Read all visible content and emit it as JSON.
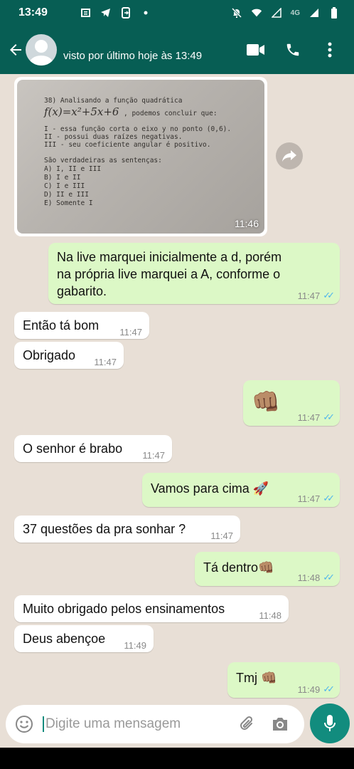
{
  "status_bar": {
    "time": "13:49",
    "network": "4G"
  },
  "header": {
    "last_seen": "visto por último hoje às 13:49"
  },
  "image_message": {
    "time": "11:46",
    "lines": [
      "38)   Analisando   a   função   quadrática",
      "f(x)=x²+5x+6",
      ", podemos concluir que:",
      "I - essa função corta o eixo y no ponto (0,6).",
      "II - possui duas raízes negativas.",
      "III - seu coeficiente angular é positivo.",
      "São verdadeiras as sentenças:",
      "A) I, II e III",
      "B) I e II",
      "C) I e III",
      "D) II e III",
      "E) Somente I"
    ]
  },
  "messages": [
    {
      "dir": "out",
      "lines": [
        "Na live marquei inicialmente a d, porém",
        "na própria live marquei a A, conforme o",
        "gabarito."
      ],
      "time": "11:47"
    },
    {
      "dir": "in",
      "text": "Então tá bom",
      "time": "11:47"
    },
    {
      "dir": "in",
      "text": "Obrigado",
      "time": "11:47"
    },
    {
      "dir": "out",
      "text": "👊🏽",
      "time": "11:47"
    },
    {
      "dir": "in",
      "text": "O senhor é brabo",
      "time": "11:47"
    },
    {
      "dir": "out",
      "text": "Vamos para cima 🚀",
      "time": "11:47"
    },
    {
      "dir": "in",
      "text": "37 questões da pra sonhar ?",
      "time": "11:47"
    },
    {
      "dir": "out",
      "text": "Tá dentro👊🏽",
      "time": "11:48"
    },
    {
      "dir": "in",
      "text": "Muito obrigado pelos ensinamentos",
      "time": "11:48"
    },
    {
      "dir": "in",
      "text": "Deus abençoe",
      "time": "11:49"
    },
    {
      "dir": "out",
      "text": "Tmj 👊🏽",
      "time": "11:49"
    }
  ],
  "input": {
    "placeholder": "Digite uma mensagem"
  },
  "colors": {
    "header": "#075e54",
    "outgoing": "#dcf8c6",
    "incoming": "#ffffff",
    "accent": "#128c7e",
    "read_ticks": "#4fb6ec"
  }
}
